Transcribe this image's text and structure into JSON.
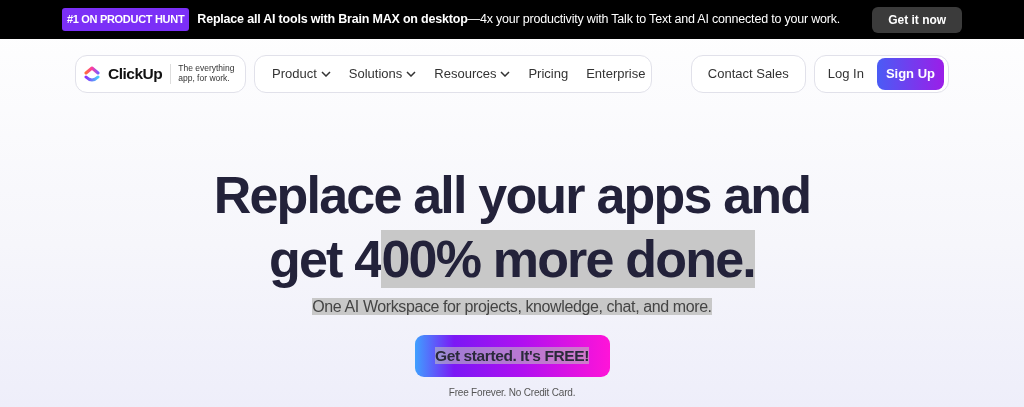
{
  "banner": {
    "badge": "#1 ON PRODUCT HUNT",
    "text": "**Replace all AI tools with Brain MAX on desktop**—4x your productivity with Talk to Text and AI connected to your work.",
    "button": "Get it now"
  },
  "brand": {
    "name": "ClickUp",
    "tagline_lines": [
      "The everything",
      "app, for work."
    ]
  },
  "nav_items": [
    {
      "label": "Product",
      "has_menu": true
    },
    {
      "label": "Solutions",
      "has_menu": true
    },
    {
      "label": "Resources",
      "has_menu": true
    },
    {
      "label": "Pricing",
      "has_menu": false
    },
    {
      "label": "Enterprise",
      "has_menu": false
    }
  ],
  "contact_button": "Contact Sales",
  "login_button": "Log In",
  "signup_button": "Sign Up",
  "hero": {
    "heading_lines": [
      [
        {
          "text": "Replace all your apps and",
          "selected": false
        }
      ],
      [
        {
          "text": "get 4",
          "selected": false
        },
        {
          "text": "00% more done.",
          "selected": true
        }
      ]
    ],
    "subtitle": {
      "text": "One AI Workspace for projects, knowledge, chat, and more.",
      "selected": true
    },
    "cta": {
      "text": "Get started. It's FREE!",
      "selected": true
    },
    "note": "Free Forever. No Credit Card."
  }
}
